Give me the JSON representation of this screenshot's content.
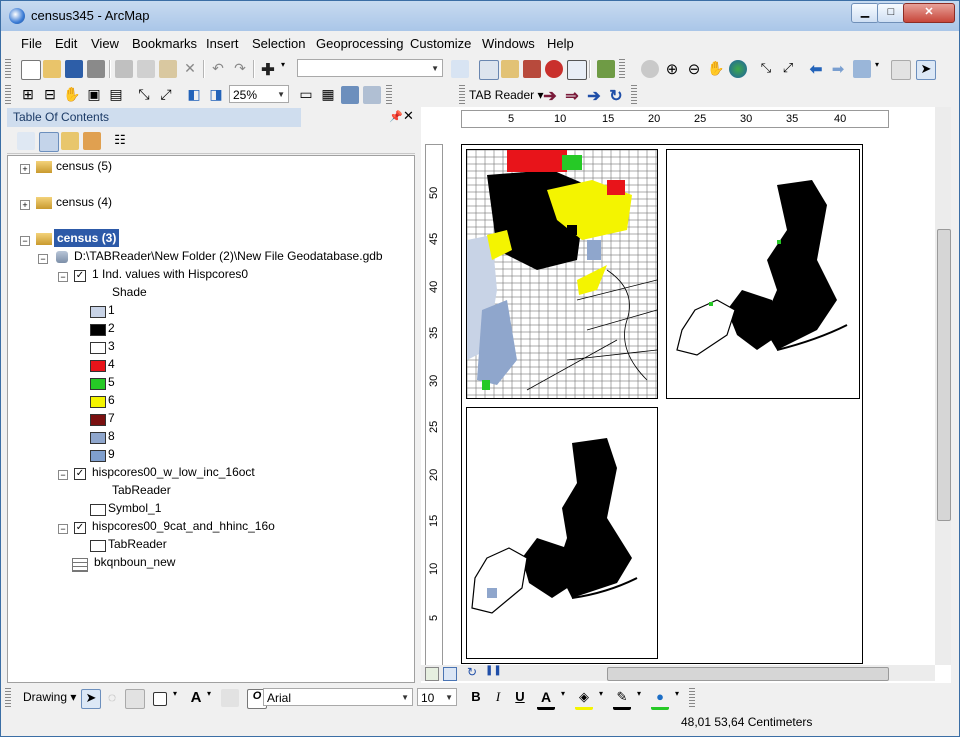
{
  "window": {
    "title": "census345 - ArcMap"
  },
  "menus": [
    "File",
    "Edit",
    "View",
    "Bookmarks",
    "Insert",
    "Selection",
    "Geoprocessing",
    "Customize",
    "Windows",
    "Help"
  ],
  "toolbar": {
    "zoom_level": "25%",
    "tab_reader_label": "TAB Reader"
  },
  "toc": {
    "title": "Table Of Contents",
    "groups": [
      {
        "name": "census (5)"
      },
      {
        "name": "census (4)"
      },
      {
        "name": "census (3)"
      }
    ],
    "gdb_path": "D:\\TABReader\\New Folder (2)\\New File Geodatabase.gdb",
    "layer1": {
      "name": "1 Ind. values with Hispcores0",
      "field": "Shade"
    },
    "legend": [
      {
        "label": "1",
        "color": "#c8d3e6"
      },
      {
        "label": "2",
        "color": "#000000"
      },
      {
        "label": "3",
        "color": "#ffffff"
      },
      {
        "label": "4",
        "color": "#e8141a"
      },
      {
        "label": "5",
        "color": "#26c926"
      },
      {
        "label": "6",
        "color": "#f4f400"
      },
      {
        "label": "7",
        "color": "#7a1010"
      },
      {
        "label": "8",
        "color": "#8fa6cc"
      },
      {
        "label": "9",
        "color": "#7f9fce"
      }
    ],
    "layer2": {
      "name": "hispcores00_w_low_inc_16oct",
      "sub": "TabReader",
      "symbol": "Symbol_1"
    },
    "layer3": {
      "name": "hispcores00_9cat_and_hhinc_16o",
      "sub": "TabReader"
    },
    "table": {
      "name": "bkqnboun_new"
    }
  },
  "ruler": {
    "h": [
      "5",
      "10",
      "15",
      "20",
      "25",
      "30",
      "35",
      "40"
    ],
    "v": [
      "50",
      "45",
      "40",
      "35",
      "30",
      "25",
      "20",
      "15",
      "10",
      "5"
    ]
  },
  "drawing": {
    "label": "Drawing",
    "font": "Arial",
    "size": "10",
    "bold": "B",
    "italic": "I",
    "underline": "U",
    "text_a": "A"
  },
  "status": {
    "coords": "48,01  53,64 Centimeters"
  }
}
